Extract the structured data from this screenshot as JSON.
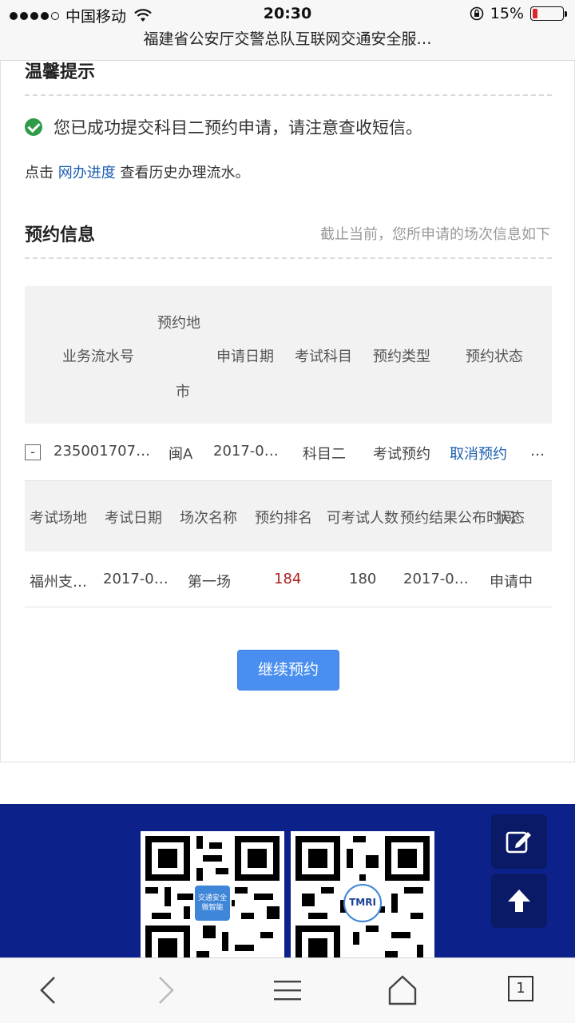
{
  "status_bar": {
    "carrier": "中国移动",
    "time": "20:30",
    "battery_text": "15%",
    "battery_level": 0.15
  },
  "url_bar": {
    "title": "福建省公安厅交警总队互联网交通安全服…"
  },
  "tip": {
    "heading": "温馨提示",
    "success_message": "您已成功提交科目二预约申请，请注意查收短信。",
    "progress_prefix": "点击",
    "progress_link": "网办进度",
    "progress_suffix": "查看历史办理流水。"
  },
  "booking": {
    "heading": "预约信息",
    "note": "截止当前，您所申请的场次信息如下",
    "table1": {
      "headers": [
        "业务流水号",
        "预约地",
        "市",
        "申请日期",
        "考试科目",
        "预约类型",
        "预约状态"
      ],
      "row": {
        "expand_symbol": "-",
        "serial": "235001707…",
        "city": "闽A",
        "date": "2017-0…",
        "subject": "科目二",
        "type": "考试预约",
        "action": "取消预约",
        "more": "…"
      }
    },
    "table2": {
      "headers": [
        "考试场地",
        "考试日期",
        "场次名称",
        "预约排名",
        "可考试人数",
        "预约结果公布时间",
        "状态"
      ],
      "row": {
        "venue": "福州支…",
        "date": "2017-0…",
        "session": "第一场",
        "rank": "184",
        "capacity": "180",
        "publish": "2017-0…",
        "status": "申请中"
      }
    },
    "continue_button": "继续预约"
  },
  "footer": {
    "qr_left_logo": "交通安全 微智能",
    "qr_right_logo": "TMRI"
  },
  "bottom_bar": {
    "tab_count": "1"
  }
}
